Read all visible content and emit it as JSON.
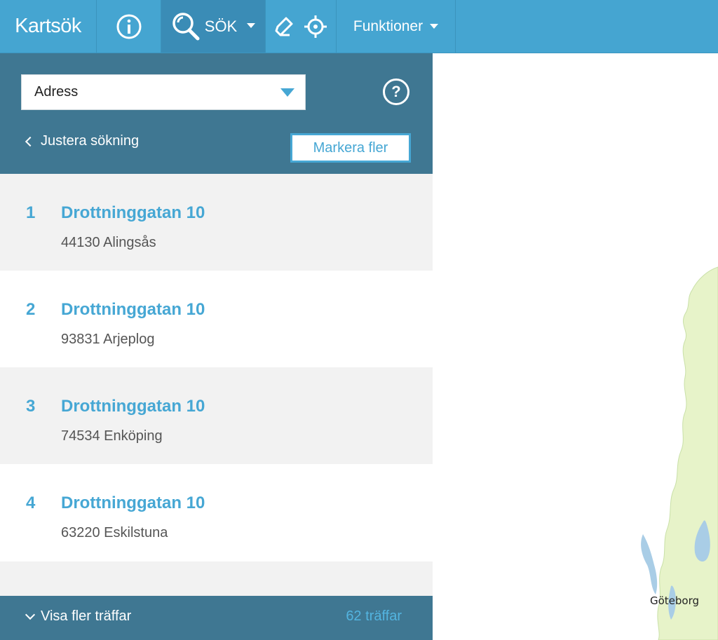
{
  "topbar": {
    "brand": "Kartsök",
    "search_label": "SÖK",
    "functions_label": "Funktioner"
  },
  "icons": {
    "info": "info-icon",
    "search": "search-icon",
    "draw": "draw-icon",
    "locate": "crosshair-icon",
    "help": "help-icon"
  },
  "search": {
    "type_value": "Adress",
    "adjust_label": "Justera sökning",
    "mark_more_label": "Markera fler"
  },
  "results": [
    {
      "num": "1",
      "title": "Drottninggatan 10",
      "sub": "44130 Alingsås"
    },
    {
      "num": "2",
      "title": "Drottninggatan 10",
      "sub": "93831 Arjeplog"
    },
    {
      "num": "3",
      "title": "Drottninggatan 10",
      "sub": "74534 Enköping"
    },
    {
      "num": "4",
      "title": "Drottninggatan 10",
      "sub": "63220 Eskilstuna"
    }
  ],
  "footer": {
    "show_more_label": "Visa fler träffar",
    "hit_count": "62 träffar"
  },
  "map": {
    "city_label": "Göteborg"
  },
  "colors": {
    "topbar": "#45a5d1",
    "panel": "#3f7792",
    "accent": "#46a7d4",
    "land": "#e7f3c9",
    "water": "#a9cde6"
  }
}
